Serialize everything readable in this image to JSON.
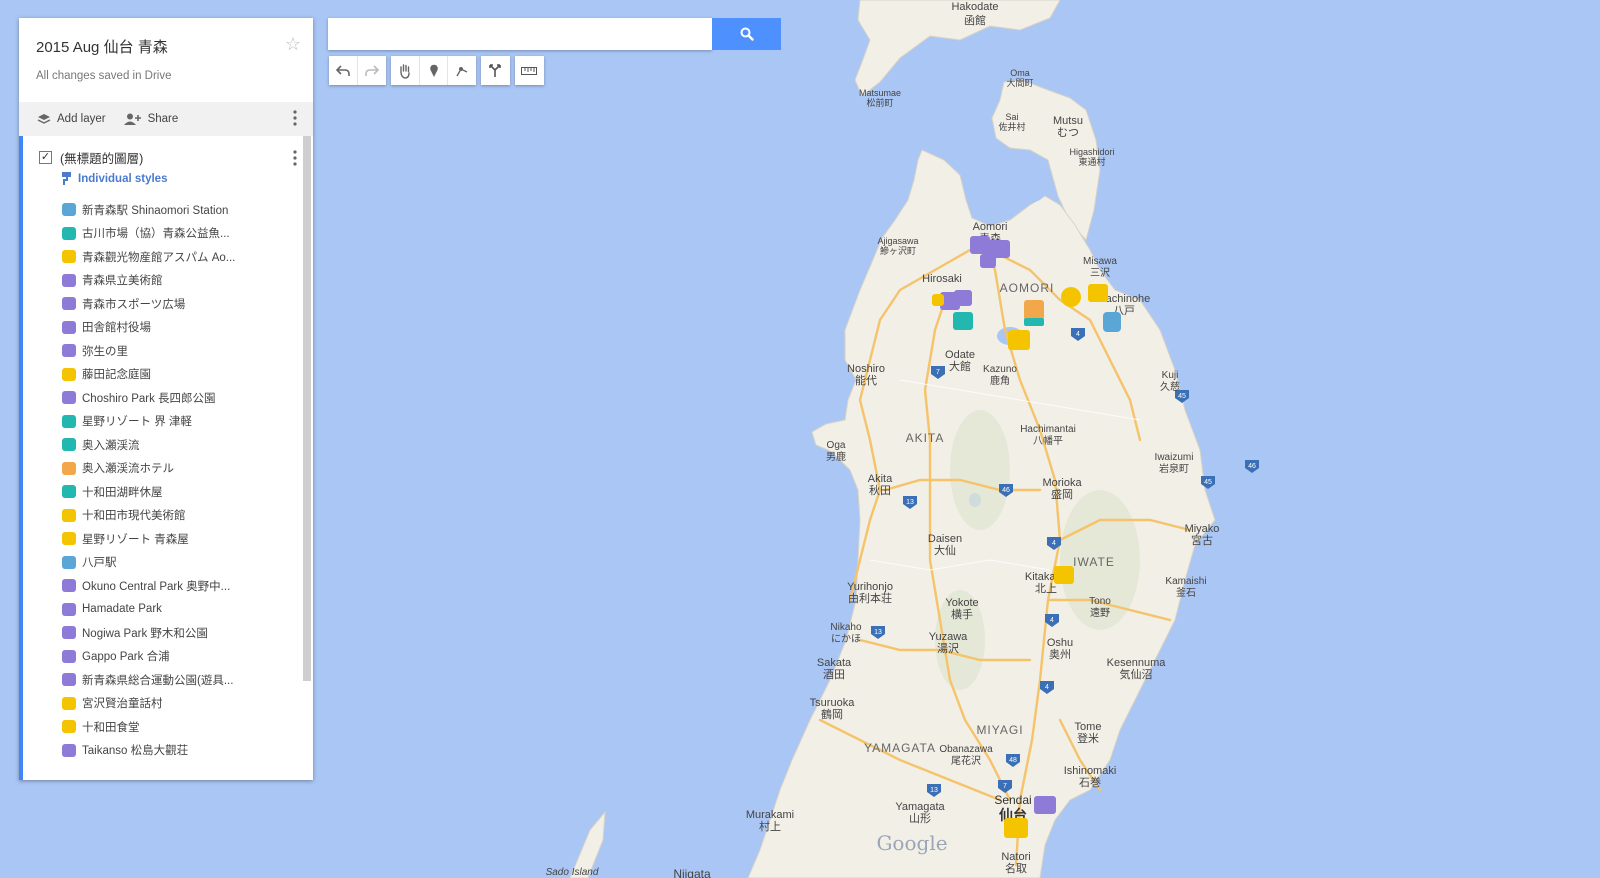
{
  "map": {
    "title": "2015 Aug 仙台 青森",
    "saved_status": "All changes saved in Drive",
    "search_placeholder": "",
    "attribution": "Google"
  },
  "toolbar": {
    "add_layer": "Add layer",
    "share": "Share"
  },
  "tools": [
    "undo",
    "redo",
    "hand",
    "marker",
    "line",
    "directions",
    "ruler"
  ],
  "layer": {
    "name": "(無標題的圖層)",
    "style_link": "Individual styles",
    "places": [
      {
        "label": "新青森駅 Shinaomori Station",
        "color": "#5aa6d6"
      },
      {
        "label": "古川市場（協）青森公益魚...",
        "color": "#22b8b0"
      },
      {
        "label": "青森觀光物産館アスパム Ao...",
        "color": "#f5c400"
      },
      {
        "label": "青森県立美術館",
        "color": "#8e7bd8"
      },
      {
        "label": "青森市スポーツ広場",
        "color": "#8e7bd8"
      },
      {
        "label": "田舎館村役場",
        "color": "#8e7bd8"
      },
      {
        "label": "弥生の里",
        "color": "#8e7bd8"
      },
      {
        "label": "藤田記念庭園",
        "color": "#f5c400"
      },
      {
        "label": "Choshiro Park 長四郎公園",
        "color": "#8e7bd8"
      },
      {
        "label": "星野リゾート 界 津軽",
        "color": "#22b8b0"
      },
      {
        "label": "奥入瀬渓流",
        "color": "#22b8b0"
      },
      {
        "label": "奥入瀬渓流ホテル",
        "color": "#f2a84a"
      },
      {
        "label": "十和田湖畔休屋",
        "color": "#22b8b0"
      },
      {
        "label": "十和田市現代美術館",
        "color": "#f5c400"
      },
      {
        "label": "星野リゾート 青森屋",
        "color": "#f5c400"
      },
      {
        "label": "八戸駅",
        "color": "#5aa6d6"
      },
      {
        "label": "Okuno Central Park 奥野中...",
        "color": "#8e7bd8"
      },
      {
        "label": "Hamadate Park",
        "color": "#8e7bd8"
      },
      {
        "label": "Nogiwa Park 野木和公園",
        "color": "#8e7bd8"
      },
      {
        "label": "Gappo Park 合浦",
        "color": "#8e7bd8"
      },
      {
        "label": "新青森県総合運動公園(遊具...",
        "color": "#8e7bd8"
      },
      {
        "label": "宮沢賢治童話村",
        "color": "#f5c400"
      },
      {
        "label": "十和田食堂",
        "color": "#f5c400"
      },
      {
        "label": "Taikanso 松島大觀荘",
        "color": "#8e7bd8"
      }
    ]
  },
  "map_labels": {
    "hakodate": "Hakodate",
    "hakodate_jp": "函館",
    "oma": "Oma",
    "oma_jp": "大間町",
    "matsumae": "Matsumae",
    "matsumae_jp": "松前町",
    "sai": "Sai",
    "sai_jp": "佐井村",
    "mutsu": "Mutsu",
    "mutsu_jp": "むつ",
    "higashidori": "Higashidori",
    "higashidori_jp": "東通村",
    "ajigasawa": "Ajigasawa",
    "ajigasawa_jp": "鰺ヶ沢町",
    "aomori": "Aomori",
    "aomori_jp": "青森",
    "misawa": "Misawa",
    "misawa_jp": "三沢",
    "hirosaki": "Hirosaki",
    "aomori_pref": "AOMORI",
    "hachinohe": "Hachinohe",
    "hachinohe_jp": "八戸",
    "odate": "Odate",
    "odate_jp": "大館",
    "kazuno": "Kazuno",
    "kazuno_jp": "鹿角",
    "noshiro": "Noshiro",
    "noshiro_jp": "能代",
    "kuji": "Kuji",
    "kuji_jp": "久慈",
    "hachimantai": "Hachimantai",
    "hachimantai_jp": "八幡平",
    "oga": "Oga",
    "oga_jp": "男鹿",
    "akita_pref": "AKITA",
    "iwaizumi": "Iwaizumi",
    "iwaizumi_jp": "岩泉町",
    "akita": "Akita",
    "akita_jp": "秋田",
    "morioka": "Morioka",
    "morioka_jp": "盛岡",
    "miyako": "Miyako",
    "miyako_jp": "宮古",
    "daisen": "Daisen",
    "daisen_jp": "大仙",
    "iwate_pref": "IWATE",
    "kitakami": "Kitakami",
    "kitakami_jp": "北上",
    "kamaishi": "Kamaishi",
    "kamaishi_jp": "釜石",
    "yurihonjo": "Yurihonjo",
    "yurihonjo_jp": "由利本荘",
    "yokote": "Yokote",
    "yokote_jp": "横手",
    "tono": "Tono",
    "tono_jp": "遠野",
    "nikaho": "Nikaho",
    "nikaho_jp": "にかほ",
    "yuzawa": "Yuzawa",
    "yuzawa_jp": "湯沢",
    "oshu": "Oshu",
    "oshu_jp": "奥州",
    "sakata": "Sakata",
    "sakata_jp": "酒田",
    "kesennuma": "Kesennuma",
    "kesennuma_jp": "気仙沼",
    "tsuruoka": "Tsuruoka",
    "tsuruoka_jp": "鶴岡",
    "miyagi_pref": "MIYAGI",
    "tome": "Tome",
    "tome_jp": "登米",
    "yamagata_pref": "YAMAGATA",
    "obanazawa": "Obanazawa",
    "obanazawa_jp": "尾花沢",
    "ishinomaki": "Ishinomaki",
    "ishinomaki_jp": "石巻",
    "murakami": "Murakami",
    "murakami_jp": "村上",
    "yamagata": "Yamagata",
    "yamagata_jp": "山形",
    "sendai": "Sendai",
    "sendai_jp": "仙台",
    "natori": "Natori",
    "natori_jp": "名取",
    "sado": "Sado Island",
    "niigata": "Niigata"
  },
  "road_shields": [
    "7",
    "4",
    "45",
    "46",
    "46",
    "13",
    "4",
    "45",
    "4",
    "4",
    "13",
    "48",
    "7",
    "13"
  ],
  "colors": {
    "sea": "#a9c6f5",
    "land": "#f2efe7",
    "accent": "#4d90fe",
    "layer_bar": "#4285f4"
  }
}
